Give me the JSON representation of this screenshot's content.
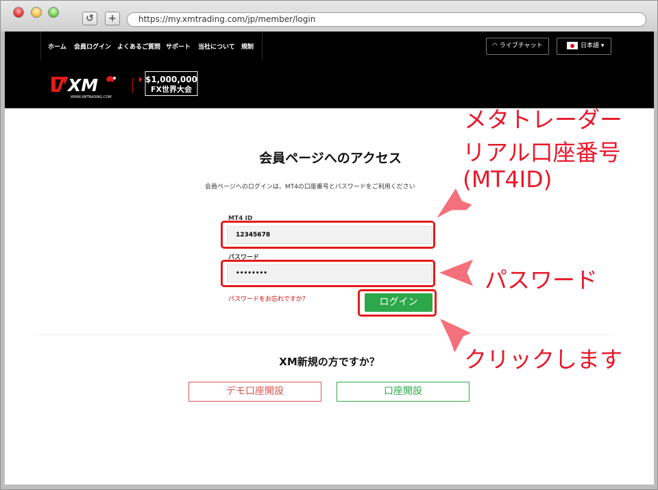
{
  "browser": {
    "url": "https://my.xmtrading.com/jp/member/login",
    "reload_glyph": "↺",
    "newtab_glyph": "+"
  },
  "nav": {
    "items": [
      "ホーム",
      "会員ログイン",
      "よくあるご質問",
      "サポート",
      "当社について",
      "規制"
    ],
    "livechat": "ライブチャット",
    "language": "日本語"
  },
  "brand": {
    "logo_text": "XM",
    "logo_sub": "WWW.XMTRADING.COM",
    "prize_amount": "$1,000,000",
    "prize_label": "FX世界大会"
  },
  "login": {
    "title": "会員ページへのアクセス",
    "subtitle": "会員ページへのログインは、MT4の口座番号とパスワードをご利用ください",
    "mt4id_label": "MT4 ID",
    "mt4id_value": "12345678",
    "password_label": "パスワード",
    "password_value": "••••••••",
    "forgot": "パスワードをお忘れですか？",
    "submit": "ログイン"
  },
  "signup": {
    "title": "XM新規の方ですか？",
    "demo": "デモ口座開設",
    "real": "口座開設"
  },
  "annotations": {
    "mt4id_line1": "メタトレーダー",
    "mt4id_line2": "リアル口座番号",
    "mt4id_line3": "(MT4ID)",
    "password": "パスワード",
    "click": "クリックします"
  },
  "colors": {
    "highlight": "#e41b1b",
    "annotation_text": "#e8182a",
    "arrow_fill": "#f4707a",
    "login_green": "#2ca84a",
    "demo_red": "#d9534f"
  }
}
